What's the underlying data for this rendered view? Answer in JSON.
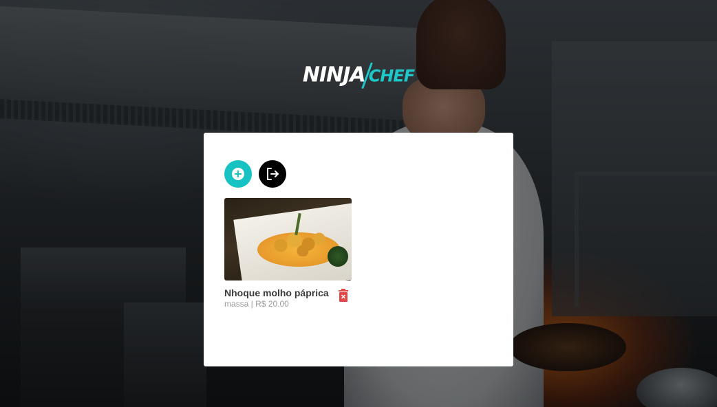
{
  "brand": {
    "ninja": "NINJA",
    "chef": "CHEF"
  },
  "actions": {
    "add_icon": "plus-circle-icon",
    "logout_icon": "logout-icon"
  },
  "recipes": [
    {
      "name": "Nhoque molho páprica",
      "meta": "massa | R$ 20.00",
      "delete_icon": "trash-icon"
    }
  ],
  "colors": {
    "accent": "#16c2c2",
    "delete": "#e04848"
  }
}
